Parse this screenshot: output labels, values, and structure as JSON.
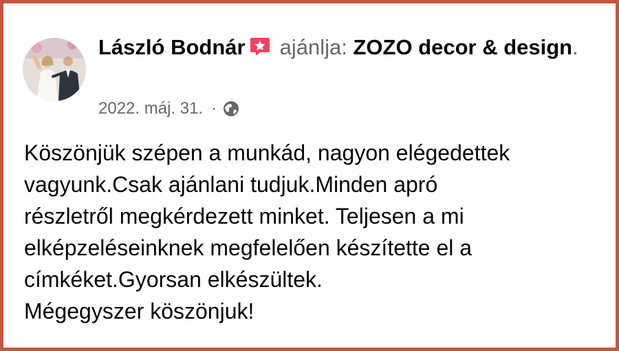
{
  "post": {
    "author_name": "László Bodnár",
    "badge_icon": "recommend-star-icon",
    "verb": "ajánlja:",
    "page_name": "ZOZO decor & design",
    "trailing_dot": ".",
    "date": "2022. máj. 31.",
    "separator": "·",
    "privacy_icon": "globe-icon",
    "text": "Köszönjük szépen a munkád, nagyon elégedettek\nvagyunk.Csak ajánlani tudjuk.Minden apró\nrészletről megkérdezett minket. Teljesen a mi\nelképzeléseinknek megfelelően készítette el a\ncímkéket.Gyorsan elkészültek.\n Mégegyszer köszönjuk!"
  },
  "colors": {
    "frame_border": "#c8553d",
    "badge": "#f3425f",
    "secondary_text": "#65676b",
    "primary_text": "#050505"
  }
}
